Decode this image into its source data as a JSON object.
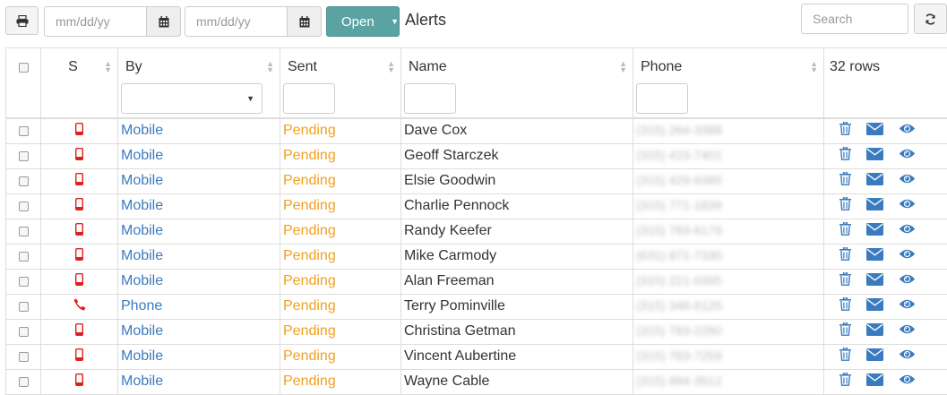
{
  "toolbar": {
    "date_from_placeholder": "mm/dd/yy",
    "date_to_placeholder": "mm/dd/yy",
    "open_label": "Open",
    "title": "Alerts",
    "search_placeholder": "Search"
  },
  "table": {
    "columns": {
      "status": "S",
      "by": "By",
      "sent": "Sent",
      "name": "Name",
      "phone": "Phone"
    },
    "rows_count": "32 rows",
    "rows": [
      {
        "icon": "mobile-icon",
        "by": "Mobile",
        "sent": "Pending",
        "name": "Dave Cox",
        "phone": "(315) 264-3388"
      },
      {
        "icon": "mobile-icon",
        "by": "Mobile",
        "sent": "Pending",
        "name": "Geoff Starczek",
        "phone": "(315) 415-7401"
      },
      {
        "icon": "mobile-icon",
        "by": "Mobile",
        "sent": "Pending",
        "name": "Elsie Goodwin",
        "phone": "(315) 429-9385"
      },
      {
        "icon": "mobile-icon",
        "by": "Mobile",
        "sent": "Pending",
        "name": "Charlie Pennock",
        "phone": "(315) 771-1839"
      },
      {
        "icon": "mobile-icon",
        "by": "Mobile",
        "sent": "Pending",
        "name": "Randy Keefer",
        "phone": "(315) 783-6179"
      },
      {
        "icon": "mobile-icon",
        "by": "Mobile",
        "sent": "Pending",
        "name": "Mike Carmody",
        "phone": "(631) 871-7330"
      },
      {
        "icon": "mobile-icon",
        "by": "Mobile",
        "sent": "Pending",
        "name": "Alan Freeman",
        "phone": "(315) 221-0395"
      },
      {
        "icon": "phone-icon",
        "by": "Phone",
        "sent": "Pending",
        "name": "Terry Pominville",
        "phone": "(315) 346-6125"
      },
      {
        "icon": "mobile-icon",
        "by": "Mobile",
        "sent": "Pending",
        "name": "Christina Getman",
        "phone": "(315) 783-2280"
      },
      {
        "icon": "mobile-icon",
        "by": "Mobile",
        "sent": "Pending",
        "name": "Vincent Aubertine",
        "phone": "(315) 783-7259"
      },
      {
        "icon": "mobile-icon",
        "by": "Mobile",
        "sent": "Pending",
        "name": "Wayne Cable",
        "phone": "(315) 894-3512"
      }
    ]
  },
  "colors": {
    "accent": "#5ba3a3",
    "link": "#3a7bbf",
    "pending": "#f0a020",
    "status_icon": "#e0201c"
  }
}
